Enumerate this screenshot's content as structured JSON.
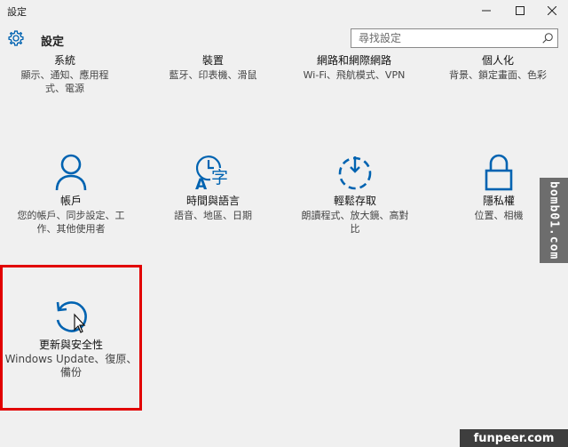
{
  "window": {
    "title": "設定",
    "controls": [
      "minimize-icon",
      "maximize-icon",
      "close-icon"
    ]
  },
  "header": {
    "icon": "gear-icon",
    "title": "設定",
    "search_placeholder": "尋找設定"
  },
  "tiles": [
    {
      "name": "系統",
      "desc": "顯示、通知、應用程式、電源",
      "icon": null
    },
    {
      "name": "裝置",
      "desc": "藍牙、印表機、滑鼠",
      "icon": null
    },
    {
      "name": "網路和網際網路",
      "desc": "Wi-Fi、飛航模式、VPN",
      "icon": null
    },
    {
      "name": "個人化",
      "desc": "背景、鎖定畫面、色彩",
      "icon": null
    },
    {
      "name": "帳戶",
      "desc": "您的帳戶、同步設定、工作、其他使用者",
      "icon": "person-icon"
    },
    {
      "name": "時間與語言",
      "desc": "語音、地區、日期",
      "icon": "time-language-icon"
    },
    {
      "name": "輕鬆存取",
      "desc": "朗讀程式、放大鏡、高對比",
      "icon": "ease-of-access-icon"
    },
    {
      "name": "隱私權",
      "desc": "位置、相機",
      "icon": "lock-icon"
    },
    {
      "name": "更新與安全性",
      "desc": "Windows Update、復原、備份",
      "icon": "update-icon"
    }
  ],
  "watermarks": {
    "side": "bomb01.com",
    "bottom": "funpeer.com"
  },
  "colors": {
    "accent": "#0063b1",
    "highlight": "#e20000",
    "background": "#f0f0f0"
  }
}
